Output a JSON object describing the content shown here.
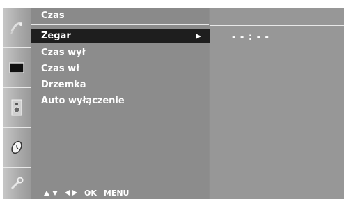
{
  "menu": {
    "title": "Czas",
    "items": [
      {
        "label": "Zegar",
        "selected": true
      },
      {
        "label": "Czas wył",
        "selected": false
      },
      {
        "label": "Czas wł",
        "selected": false
      },
      {
        "label": "Drzemka",
        "selected": false
      },
      {
        "label": "Auto wyłączenie",
        "selected": false
      }
    ]
  },
  "value_panel": {
    "clock_value": "- - : - -"
  },
  "footer": {
    "ok_label": "OK",
    "menu_label": "MENU"
  },
  "icons": [
    "satellite-dish-icon",
    "screen-icon",
    "speaker-icon",
    "clock-icon",
    "wrench-icon"
  ],
  "colors": {
    "panel": "#8c8c8c",
    "selected": "#1e1e1e",
    "text": "#ffffff"
  }
}
